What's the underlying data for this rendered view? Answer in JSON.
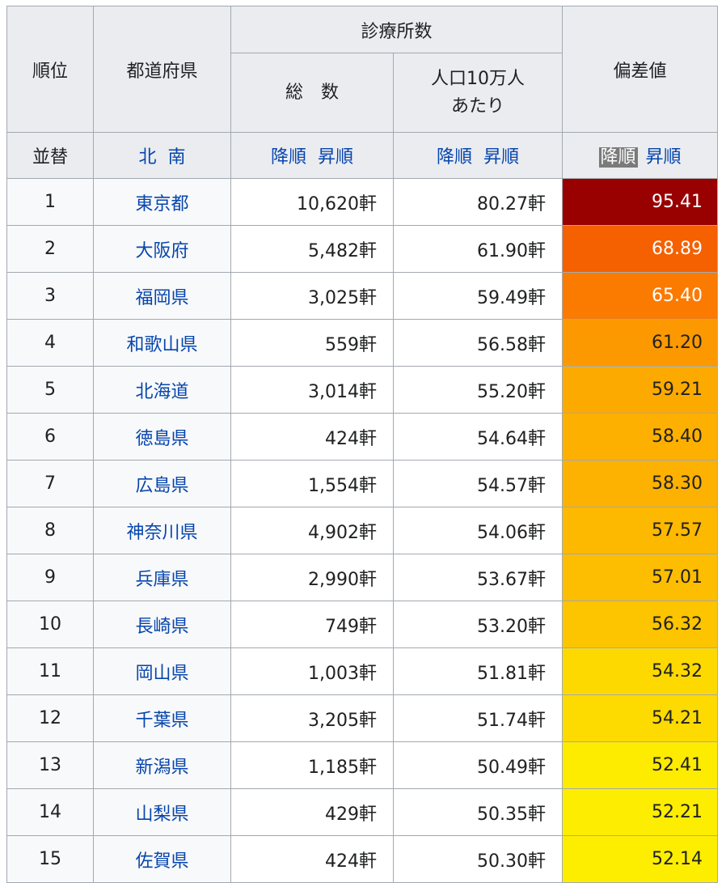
{
  "header": {
    "rank": "順位",
    "prefecture": "都道府県",
    "clinics": "診療所数",
    "total": "総　数",
    "per_100k_line1": "人口10万人",
    "per_100k_line2": "あたり",
    "deviation": "偏差値"
  },
  "sort_row": {
    "reorder": "並替",
    "north": "北",
    "south": "南",
    "desc": "降順",
    "asc": "昇順",
    "desc2": "降順",
    "asc2": "昇順",
    "desc3": "降順",
    "asc3": "昇順"
  },
  "rows": [
    {
      "rank": "1",
      "pref": "東京都",
      "total": "10,620軒",
      "per": "80.27軒",
      "dev": "95.41",
      "bg": "#990000",
      "fg": "#ffffff"
    },
    {
      "rank": "2",
      "pref": "大阪府",
      "total": "5,482軒",
      "per": "61.90軒",
      "dev": "68.89",
      "bg": "#f56000",
      "fg": "#ffffff"
    },
    {
      "rank": "3",
      "pref": "福岡県",
      "total": "3,025軒",
      "per": "59.49軒",
      "dev": "65.40",
      "bg": "#fb7a00",
      "fg": "#ffffff"
    },
    {
      "rank": "4",
      "pref": "和歌山県",
      "total": "559軒",
      "per": "56.58軒",
      "dev": "61.20",
      "bg": "#fd9900",
      "fg": "#202122"
    },
    {
      "rank": "5",
      "pref": "北海道",
      "total": "3,014軒",
      "per": "55.20軒",
      "dev": "59.21",
      "bg": "#fdaa00",
      "fg": "#202122"
    },
    {
      "rank": "6",
      "pref": "徳島県",
      "total": "424軒",
      "per": "54.64軒",
      "dev": "58.40",
      "bg": "#fdb000",
      "fg": "#202122"
    },
    {
      "rank": "7",
      "pref": "広島県",
      "total": "1,554軒",
      "per": "54.57軒",
      "dev": "58.30",
      "bg": "#fdb100",
      "fg": "#202122"
    },
    {
      "rank": "8",
      "pref": "神奈川県",
      "total": "4,902軒",
      "per": "54.06軒",
      "dev": "57.57",
      "bg": "#fdb800",
      "fg": "#202122"
    },
    {
      "rank": "9",
      "pref": "兵庫県",
      "total": "2,990軒",
      "per": "53.67軒",
      "dev": "57.01",
      "bg": "#fdbd00",
      "fg": "#202122"
    },
    {
      "rank": "10",
      "pref": "長崎県",
      "total": "749軒",
      "per": "53.20軒",
      "dev": "56.32",
      "bg": "#fdc400",
      "fg": "#202122"
    },
    {
      "rank": "11",
      "pref": "岡山県",
      "total": "1,003軒",
      "per": "51.81軒",
      "dev": "54.32",
      "bg": "#fdd900",
      "fg": "#202122"
    },
    {
      "rank": "12",
      "pref": "千葉県",
      "total": "3,205軒",
      "per": "51.74軒",
      "dev": "54.21",
      "bg": "#fdda00",
      "fg": "#202122"
    },
    {
      "rank": "13",
      "pref": "新潟県",
      "total": "1,185軒",
      "per": "50.49軒",
      "dev": "52.41",
      "bg": "#fdeb00",
      "fg": "#202122"
    },
    {
      "rank": "14",
      "pref": "山梨県",
      "total": "429軒",
      "per": "50.35軒",
      "dev": "52.21",
      "bg": "#fded00",
      "fg": "#202122"
    },
    {
      "rank": "15",
      "pref": "佐賀県",
      "total": "424軒",
      "per": "50.30軒",
      "dev": "52.14",
      "bg": "#fdee00",
      "fg": "#202122"
    }
  ]
}
